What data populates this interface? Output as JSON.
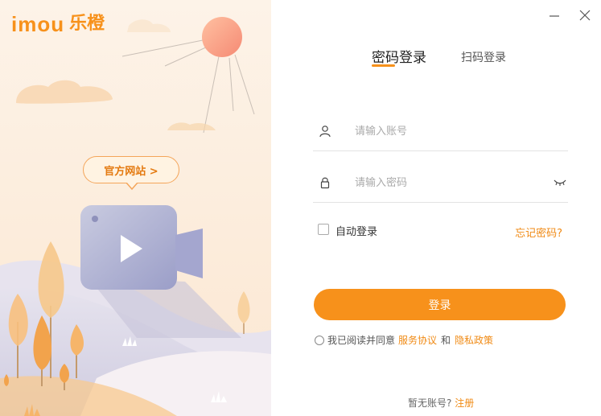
{
  "brand": {
    "name_en": "imou",
    "name_cn": "乐橙"
  },
  "illustration": {
    "official_site_label": "官方网站 >"
  },
  "window": {
    "minimize_icon": "minimize-icon",
    "close_icon": "close-icon"
  },
  "tabs": [
    {
      "label": "密码登录",
      "active": true
    },
    {
      "label": "扫码登录",
      "active": false
    }
  ],
  "form": {
    "account_placeholder": "请输入账号",
    "password_placeholder": "请输入密码",
    "account_icon": "user-icon",
    "password_icon": "lock-icon",
    "toggle_icon": "eye-closed-icon",
    "auto_login_label": "自动登录",
    "forgot_password": "忘记密码?",
    "login_button": "登录"
  },
  "agreement": {
    "prefix": "我已阅读并同意",
    "service_link": "服务协议",
    "conjunction": "和",
    "privacy_link": "隐私政策"
  },
  "register": {
    "prompt": "暂无账号?",
    "link": "注册"
  },
  "colors": {
    "accent": "#f7911b",
    "link": "#f08a14",
    "illustration_bg": "#fdf0e3"
  }
}
